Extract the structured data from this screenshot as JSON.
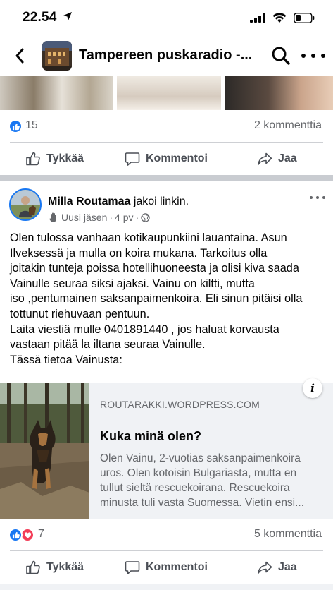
{
  "status_bar": {
    "time": "22.54",
    "icons": [
      "location-arrow-icon",
      "cellular-signal-icon",
      "wifi-icon",
      "battery-icon"
    ]
  },
  "nav": {
    "title": "Tampereen puskaradio -...",
    "icons": [
      "back-chevron-icon",
      "search-icon",
      "more-icon"
    ]
  },
  "previous_post": {
    "reactions": {
      "count": "15",
      "types": [
        "like"
      ]
    },
    "comments": "2 kommenttia",
    "actions": {
      "like": "Tykkää",
      "comment": "Kommentoi",
      "share": "Jaa"
    }
  },
  "post": {
    "author": "Milla Routamaa",
    "action_text": "jakoi linkin.",
    "meta": {
      "badge": "Uusi jäsen",
      "separator": "·",
      "age": "4 pv",
      "separator2": "·",
      "audience_icon": "globe-icon"
    },
    "body_lines": [
      "Olen tulossa vanhaan kotikaupunkiini lauantaina. Asun",
      "Ilveksessä ja mulla on koira mukana. Tarkoitus olla",
      "joitakin tunteja poissa hotellihuoneesta ja olisi kiva saada",
      "Vainulle seuraa siksi ajaksi. Vainu on kiltti, mutta",
      "iso ,pentumainen saksanpaimenkoira. Eli sinun pitäisi olla",
      "tottunut riehuvaan pentuun.",
      "Laita viestiä mulle 0401891440 , jos haluat korvausta",
      "vastaan pitää la iltana seuraa Vainulle.",
      "Tässä tietoa Vainusta:"
    ],
    "link": {
      "domain": "ROUTARAKKI.WORDPRESS.COM",
      "title": "Kuka minä olen?",
      "description_lines": [
        "Olen Vainu, 2-vuotias saksanpaimenkoira",
        "uros. Olen kotoisin Bulgariasta, mutta en",
        "tullut sieltä rescuekoirana. Rescuekoira",
        "minusta tuli vasta Suomessa. Vietin ensi..."
      ],
      "info_badge": "i"
    },
    "reactions": {
      "count": "7",
      "types": [
        "like",
        "love"
      ]
    },
    "comments": "5 kommenttia",
    "actions": {
      "like": "Tykkää",
      "comment": "Kommentoi",
      "share": "Jaa"
    }
  },
  "colors": {
    "brand_blue": "#1877f2",
    "love_red": "#f33e58",
    "secondary_text": "#65676b",
    "action_text": "#4b4f56",
    "separator": "#c9ccd1",
    "card_bg": "#f0f2f5"
  }
}
